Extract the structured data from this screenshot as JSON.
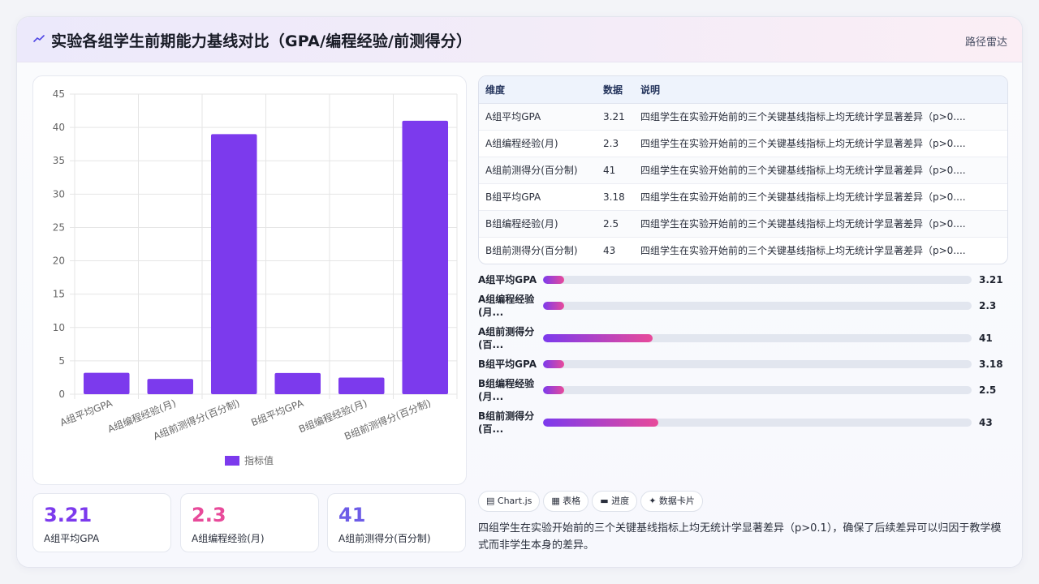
{
  "header": {
    "title": "实验各组学生前期能力基线对比（GPA/编程经验/前测得分）",
    "tag": "路径雷达"
  },
  "chart_data": {
    "type": "bar",
    "categories": [
      "A组平均GPA",
      "A组编程经验(月)",
      "A组前测得分(百分制)",
      "B组平均GPA",
      "B组编程经验(月)",
      "B组前测得分(百分制)"
    ],
    "series": [
      {
        "name": "指标值",
        "values": [
          3.21,
          2.3,
          39,
          3.18,
          2.5,
          41
        ]
      }
    ],
    "ylim": [
      0,
      45
    ],
    "yticks": [
      0,
      5,
      10,
      15,
      20,
      25,
      30,
      35,
      40,
      45
    ],
    "grid": true,
    "legend_position": "bottom",
    "colors": {
      "bar": "#7c3aed"
    }
  },
  "stats": [
    {
      "value": "3.21",
      "label": "A组平均GPA",
      "color": "#7c3aed"
    },
    {
      "value": "2.3",
      "label": "A组编程经验(月)",
      "color": "#e84a9a"
    },
    {
      "value": "41",
      "label": "A组前测得分(百分制)",
      "color": "#6d5ce7"
    }
  ],
  "table": {
    "headers": [
      "维度",
      "数据",
      "说明"
    ],
    "rows": [
      [
        "A组平均GPA",
        "3.21",
        "四组学生在实验开始前的三个关键基线指标上均无统计学显著差异（p>0...."
      ],
      [
        "A组编程经验(月)",
        "2.3",
        "四组学生在实验开始前的三个关键基线指标上均无统计学显著差异（p>0...."
      ],
      [
        "A组前测得分(百分制)",
        "41",
        "四组学生在实验开始前的三个关键基线指标上均无统计学显著差异（p>0...."
      ],
      [
        "B组平均GPA",
        "3.18",
        "四组学生在实验开始前的三个关键基线指标上均无统计学显著差异（p>0...."
      ],
      [
        "B组编程经验(月)",
        "2.5",
        "四组学生在实验开始前的三个关键基线指标上均无统计学显著差异（p>0...."
      ],
      [
        "B组前测得分(百分制)",
        "43",
        "四组学生在实验开始前的三个关键基线指标上均无统计学显著差异（p>0...."
      ]
    ]
  },
  "progress": {
    "max": 160,
    "items": [
      {
        "label": "A组平均GPA",
        "value": 3.21,
        "display": "3.21"
      },
      {
        "label": "A组编程经验(月...",
        "value": 2.3,
        "display": "2.3"
      },
      {
        "label": "A组前测得分(百...",
        "value": 41,
        "display": "41"
      },
      {
        "label": "B组平均GPA",
        "value": 3.18,
        "display": "3.18"
      },
      {
        "label": "B组编程经验(月...",
        "value": 2.5,
        "display": "2.5"
      },
      {
        "label": "B组前测得分(百...",
        "value": 43,
        "display": "43"
      }
    ]
  },
  "chips": [
    "▤ Chart.js",
    "▦ 表格",
    "▬ 进度",
    "✦ 数据卡片"
  ],
  "note": "四组学生在实验开始前的三个关键基线指标上均无统计学显著差异（p>0.1），确保了后续差异可以归因于教学模式而非学生本身的差异。"
}
